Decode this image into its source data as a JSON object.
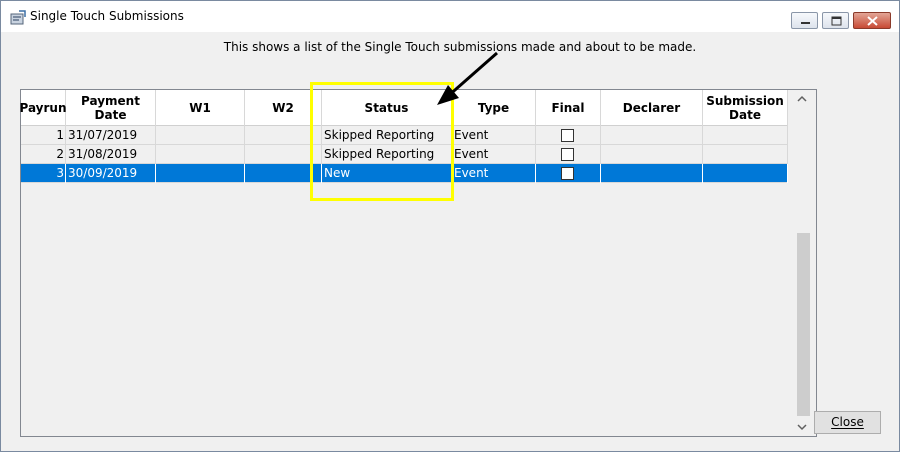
{
  "window": {
    "title": "Single Touch Submissions",
    "controls": [
      "minimize",
      "maximize",
      "close"
    ]
  },
  "info_text": "This shows a list of the Single Touch submissions made and about to be made.",
  "table": {
    "columns": [
      {
        "label": "Payrun"
      },
      {
        "label": "Payment Date"
      },
      {
        "label": "W1"
      },
      {
        "label": "W2"
      },
      {
        "label": "Status"
      },
      {
        "label": "Type"
      },
      {
        "label": "Final"
      },
      {
        "label": "Declarer"
      },
      {
        "label": "Submission Date"
      }
    ],
    "rows": [
      {
        "payrun": "1",
        "payment_date": "31/07/2019",
        "w1": "",
        "w2": "",
        "status": "Skipped Reporting",
        "type": "Event",
        "final": false,
        "declarer": "",
        "submission_date": "",
        "selected": false
      },
      {
        "payrun": "2",
        "payment_date": "31/08/2019",
        "w1": "",
        "w2": "",
        "status": "Skipped Reporting",
        "type": "Event",
        "final": false,
        "declarer": "",
        "submission_date": "",
        "selected": false
      },
      {
        "payrun": "3",
        "payment_date": "30/09/2019",
        "w1": "",
        "w2": "",
        "status": "New",
        "type": "Event",
        "final": false,
        "declarer": "",
        "submission_date": "",
        "selected": true
      }
    ]
  },
  "buttons": {
    "close_label": "Close"
  },
  "colors": {
    "selection": "#0078d7",
    "highlight_box": "#ffff00",
    "annotation_arrow": "#000000"
  },
  "annotation": {
    "highlighted_column": "Status"
  }
}
